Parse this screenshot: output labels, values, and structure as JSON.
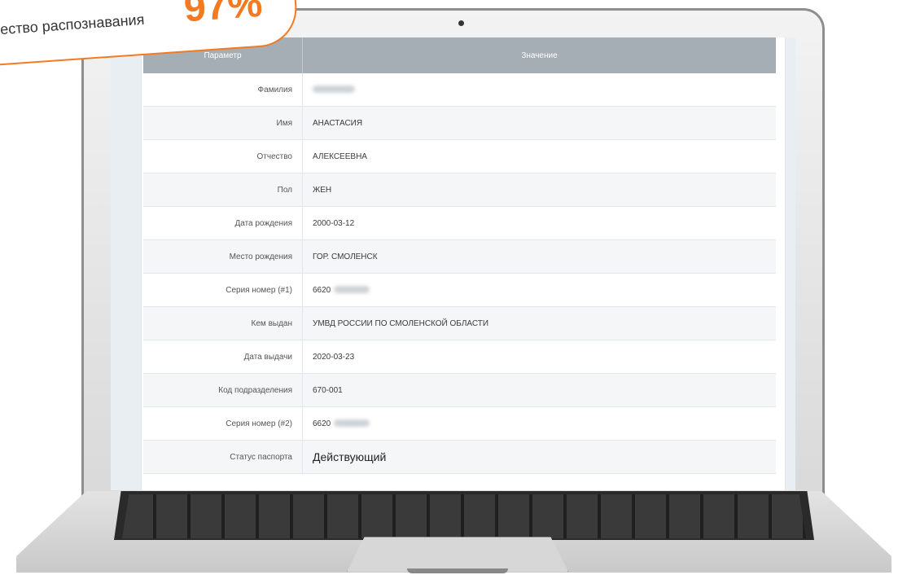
{
  "badge": {
    "text": "ество распознавания",
    "value": "97%"
  },
  "table": {
    "header_param": "Параметр",
    "header_value": "Значение",
    "rows": [
      {
        "param": "Фамилия",
        "value": ""
      },
      {
        "param": "Имя",
        "value": "АНАСТАСИЯ"
      },
      {
        "param": "Отчество",
        "value": "АЛЕКСЕЕВНА"
      },
      {
        "param": "Пол",
        "value": "ЖЕН"
      },
      {
        "param": "Дата рождения",
        "value": "2000-03-12"
      },
      {
        "param": "Место рождения",
        "value": "ГОР. СМОЛЕНСК"
      },
      {
        "param": "Серия номер (#1)",
        "value": "6620"
      },
      {
        "param": "Кем выдан",
        "value": "УМВД РОССИИ ПО СМОЛЕНСКОЙ ОБЛАСТИ"
      },
      {
        "param": "Дата выдачи",
        "value": "2020-03-23"
      },
      {
        "param": "Код подразделения",
        "value": "670-001"
      },
      {
        "param": "Серия номер (#2)",
        "value": "6620"
      },
      {
        "param": "Статус паспорта",
        "value": "Действующий"
      }
    ]
  },
  "colors": {
    "accent": "#f47a20",
    "table_header": "#a5adb5"
  }
}
